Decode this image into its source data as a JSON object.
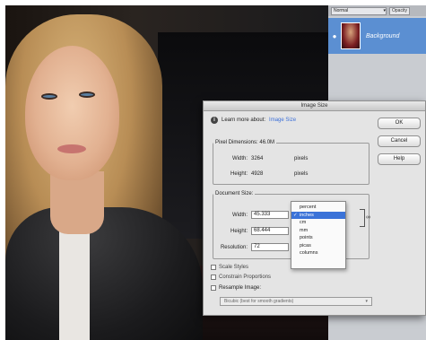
{
  "layers": {
    "blend_mode": "Normal",
    "opacity_label": "Opacity",
    "layer_name": "Background"
  },
  "dialog": {
    "title": "Image Size",
    "learn_label": "Learn more about:",
    "learn_link": "Image Size",
    "buttons": {
      "ok": "OK",
      "cancel": "Cancel",
      "help": "Help"
    },
    "pixel_dimensions": {
      "legend": "Pixel Dimensions: 46.0M",
      "width_label": "Width:",
      "width_value": "3264",
      "width_unit": "pixels",
      "height_label": "Height:",
      "height_value": "4928",
      "height_unit": "pixels"
    },
    "document_size": {
      "legend": "Document Size:",
      "width_label": "Width:",
      "width_value": "45.333",
      "height_label": "Height:",
      "height_value": "68.444",
      "resolution_label": "Resolution:",
      "resolution_value": "72"
    },
    "options": {
      "scale_styles": "Scale Styles",
      "constrain": "Constrain Proportions",
      "resample": "Resample Image:",
      "resample_method": "Bicubic (best for smooth gradients)"
    },
    "unit_menu": {
      "check_mark": "✓",
      "items": [
        "percent",
        "inches",
        "cm",
        "mm",
        "points",
        "picas",
        "columns"
      ],
      "selected_index": 1
    }
  }
}
